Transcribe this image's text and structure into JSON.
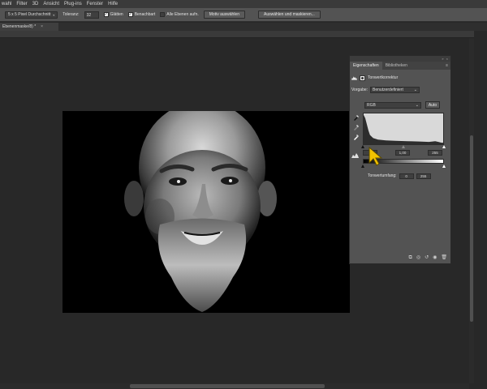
{
  "menubar": {
    "items": [
      "wahl",
      "Filter",
      "3D",
      "Ansicht",
      "Plug-ins",
      "Fenster",
      "Hilfe"
    ]
  },
  "options": {
    "sample_size": "5 x 5 Pixel Durchschnitt",
    "tolerance_label": "Toleranz:",
    "tolerance_value": "32",
    "smooth_label": "Glätten",
    "contiguous_label": "Benachbart",
    "all_layers_label": "Alle Ebenen aufn.",
    "subject_button": "Motiv auswählen",
    "select_mask_button": "Auswählen und maskieren..."
  },
  "document": {
    "tab_title": "Ebenenmaske/8) *",
    "close": "×"
  },
  "panel": {
    "tab_properties": "Eigenschaften",
    "tab_library": "Bibliotheken",
    "menu_glyph": "≡",
    "adjustment_title": "Tonwertkorrektur",
    "preset_label": "Vorgabe:",
    "preset_value": "Benutzerdefiniert",
    "channel_value": "RGB",
    "auto_button": "Auto",
    "input_black": "0",
    "input_gamma": "1,00",
    "input_white": "255",
    "output_label": "Tonwertumfang:",
    "output_black": "0",
    "output_white": "255",
    "chevron": "⌄",
    "collapse": "»",
    "close": "×"
  },
  "colors": {
    "cursor_yellow": "#f2c200",
    "ui_dark": "#282828",
    "panel_gray": "#535353"
  },
  "icons": [
    "eyedropper-black-icon",
    "eyedropper-gray-icon",
    "eyedropper-white-icon",
    "clip-icon",
    "layers-icon",
    "visibility-icon",
    "reset-icon",
    "trash-icon"
  ]
}
